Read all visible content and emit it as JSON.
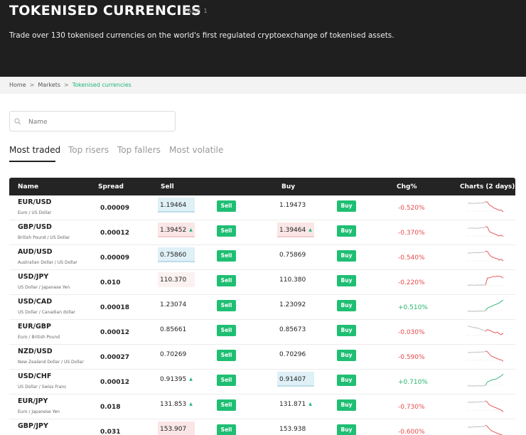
{
  "hero": {
    "title": "TOKENISED CURRENCIES",
    "page_label": "PAGE 1",
    "subtitle": "Trade over 130 tokenised currencies on the world's first regulated cryptoexchange of tokenised assets."
  },
  "breadcrumb": {
    "home": "Home",
    "markets": "Markets",
    "current": "Tokenised currencies"
  },
  "search": {
    "placeholder": "Name",
    "value": "",
    "icon": "search-icon"
  },
  "tabs": [
    "Most traded",
    "Top risers",
    "Top fallers",
    "Most volatile"
  ],
  "active_tab": "Most traded",
  "table": {
    "headers": {
      "name": "Name",
      "spread": "Spread",
      "sell": "Sell",
      "buy": "Buy",
      "chg": "Chg%",
      "charts": "Charts (2 days)"
    },
    "sell_label": "Sell",
    "buy_label": "Buy",
    "colors": {
      "positive": "#21b36b",
      "negative": "#e64a4a",
      "button": "#1fbf73"
    },
    "rows": [
      {
        "pair": "EUR/USD",
        "desc": "Euro / US Dollar",
        "spread": "0.00009",
        "sell": "1.19464",
        "sell_arrow": "",
        "sell_state": "up",
        "buy": "1.19473",
        "buy_arrow": "",
        "buy_state": "plain",
        "chg": "-0.520%",
        "trend": "neg",
        "spark": [
          0.7,
          0.72,
          0.7,
          0.71,
          0.7,
          0.72,
          0.71,
          0.73,
          0.72,
          0.8,
          0.78,
          0.6,
          0.55,
          0.45,
          0.4,
          0.35,
          0.3,
          0.32,
          0.2
        ]
      },
      {
        "pair": "GBP/USD",
        "desc": "British Pound / US Dollar",
        "spread": "0.00012",
        "sell": "1.39452",
        "sell_arrow": "▲",
        "sell_state": "down",
        "buy": "1.39464",
        "buy_arrow": "▲",
        "buy_state": "down",
        "chg": "-0.370%",
        "trend": "neg",
        "spark": [
          0.7,
          0.71,
          0.72,
          0.7,
          0.71,
          0.7,
          0.72,
          0.74,
          0.72,
          0.8,
          0.78,
          0.5,
          0.45,
          0.4,
          0.35,
          0.3,
          0.25,
          0.3,
          0.22
        ]
      },
      {
        "pair": "AUD/USD",
        "desc": "Australian Dollar / US Dollar",
        "spread": "0.00009",
        "sell": "0.75860",
        "sell_arrow": "",
        "sell_state": "up",
        "buy": "0.75869",
        "buy_arrow": "",
        "buy_state": "plain",
        "chg": "-0.540%",
        "trend": "neg",
        "spark": [
          0.7,
          0.72,
          0.71,
          0.73,
          0.72,
          0.74,
          0.72,
          0.75,
          0.74,
          0.82,
          0.8,
          0.6,
          0.5,
          0.45,
          0.4,
          0.38,
          0.3,
          0.35,
          0.25
        ]
      },
      {
        "pair": "USD/JPY",
        "desc": "US Dollar / Japanese Yen",
        "spread": "0.010",
        "sell": "110.370",
        "sell_arrow": "",
        "sell_state": "none",
        "buy": "110.380",
        "buy_arrow": "",
        "buy_state": "plain",
        "chg": "-0.220%",
        "trend": "neg",
        "spark": [
          0.3,
          0.28,
          0.3,
          0.27,
          0.29,
          0.3,
          0.28,
          0.3,
          0.29,
          0.3,
          0.7,
          0.72,
          0.75,
          0.8,
          0.78,
          0.82,
          0.8,
          0.78,
          0.7
        ]
      },
      {
        "pair": "USD/CAD",
        "desc": "US Dollar / Canadian dollar",
        "spread": "0.00018",
        "sell": "1.23074",
        "sell_arrow": "",
        "sell_state": "plain",
        "buy": "1.23092",
        "buy_arrow": "",
        "buy_state": "plain",
        "chg": "+0.510%",
        "trend": "pos",
        "spark": [
          0.2,
          0.22,
          0.2,
          0.21,
          0.2,
          0.22,
          0.21,
          0.22,
          0.21,
          0.25,
          0.4,
          0.45,
          0.5,
          0.55,
          0.6,
          0.65,
          0.7,
          0.8,
          0.85
        ]
      },
      {
        "pair": "EUR/GBP",
        "desc": "Euro / British Pound",
        "spread": "0.00012",
        "sell": "0.85661",
        "sell_arrow": "",
        "sell_state": "plain",
        "buy": "0.85673",
        "buy_arrow": "",
        "buy_state": "plain",
        "chg": "-0.030%",
        "trend": "neg",
        "spark": [
          0.8,
          0.78,
          0.75,
          0.72,
          0.7,
          0.68,
          0.65,
          0.6,
          0.55,
          0.5,
          0.6,
          0.55,
          0.5,
          0.45,
          0.4,
          0.45,
          0.35,
          0.3,
          0.4
        ]
      },
      {
        "pair": "NZD/USD",
        "desc": "New Zealand Dollar / US Dollar",
        "spread": "0.00027",
        "sell": "0.70269",
        "sell_arrow": "",
        "sell_state": "plain",
        "buy": "0.70296",
        "buy_arrow": "",
        "buy_state": "plain",
        "chg": "-0.590%",
        "trend": "neg",
        "spark": [
          0.7,
          0.72,
          0.7,
          0.73,
          0.72,
          0.74,
          0.73,
          0.75,
          0.74,
          0.8,
          0.75,
          0.6,
          0.5,
          0.45,
          0.4,
          0.35,
          0.3,
          0.28,
          0.2
        ]
      },
      {
        "pair": "USD/CHF",
        "desc": "US Dollar / Swiss Franc",
        "spread": "0.00012",
        "sell": "0.91395",
        "sell_arrow": "▲",
        "sell_state": "plain",
        "buy": "0.91407",
        "buy_arrow": "",
        "buy_state": "up",
        "chg": "+0.710%",
        "trend": "pos",
        "spark": [
          0.2,
          0.22,
          0.21,
          0.2,
          0.22,
          0.21,
          0.22,
          0.2,
          0.22,
          0.25,
          0.45,
          0.5,
          0.55,
          0.58,
          0.6,
          0.65,
          0.72,
          0.8,
          0.9
        ]
      },
      {
        "pair": "EUR/JPY",
        "desc": "Euro / Japanese Yen",
        "spread": "0.018",
        "sell": "131.853",
        "sell_arrow": "▲",
        "sell_state": "plain",
        "buy": "131.871",
        "buy_arrow": "▲",
        "buy_state": "plain",
        "chg": "-0.730%",
        "trend": "neg",
        "spark": [
          0.7,
          0.72,
          0.7,
          0.72,
          0.71,
          0.73,
          0.72,
          0.74,
          0.73,
          0.8,
          0.7,
          0.55,
          0.5,
          0.45,
          0.4,
          0.35,
          0.3,
          0.25,
          0.15
        ]
      },
      {
        "pair": "GBP/JPY",
        "desc": "",
        "spread": "0.031",
        "sell": "153.907",
        "sell_arrow": "",
        "sell_state": "down",
        "buy": "153.938",
        "buy_arrow": "",
        "buy_state": "plain",
        "chg": "-0.600%",
        "trend": "neg",
        "spark": [
          0.7,
          0.72,
          0.7,
          0.73,
          0.72,
          0.74,
          0.72,
          0.75,
          0.74,
          0.82,
          0.75,
          0.6,
          0.5,
          0.45,
          0.4,
          0.35,
          0.3,
          0.28,
          0.2
        ]
      }
    ]
  }
}
